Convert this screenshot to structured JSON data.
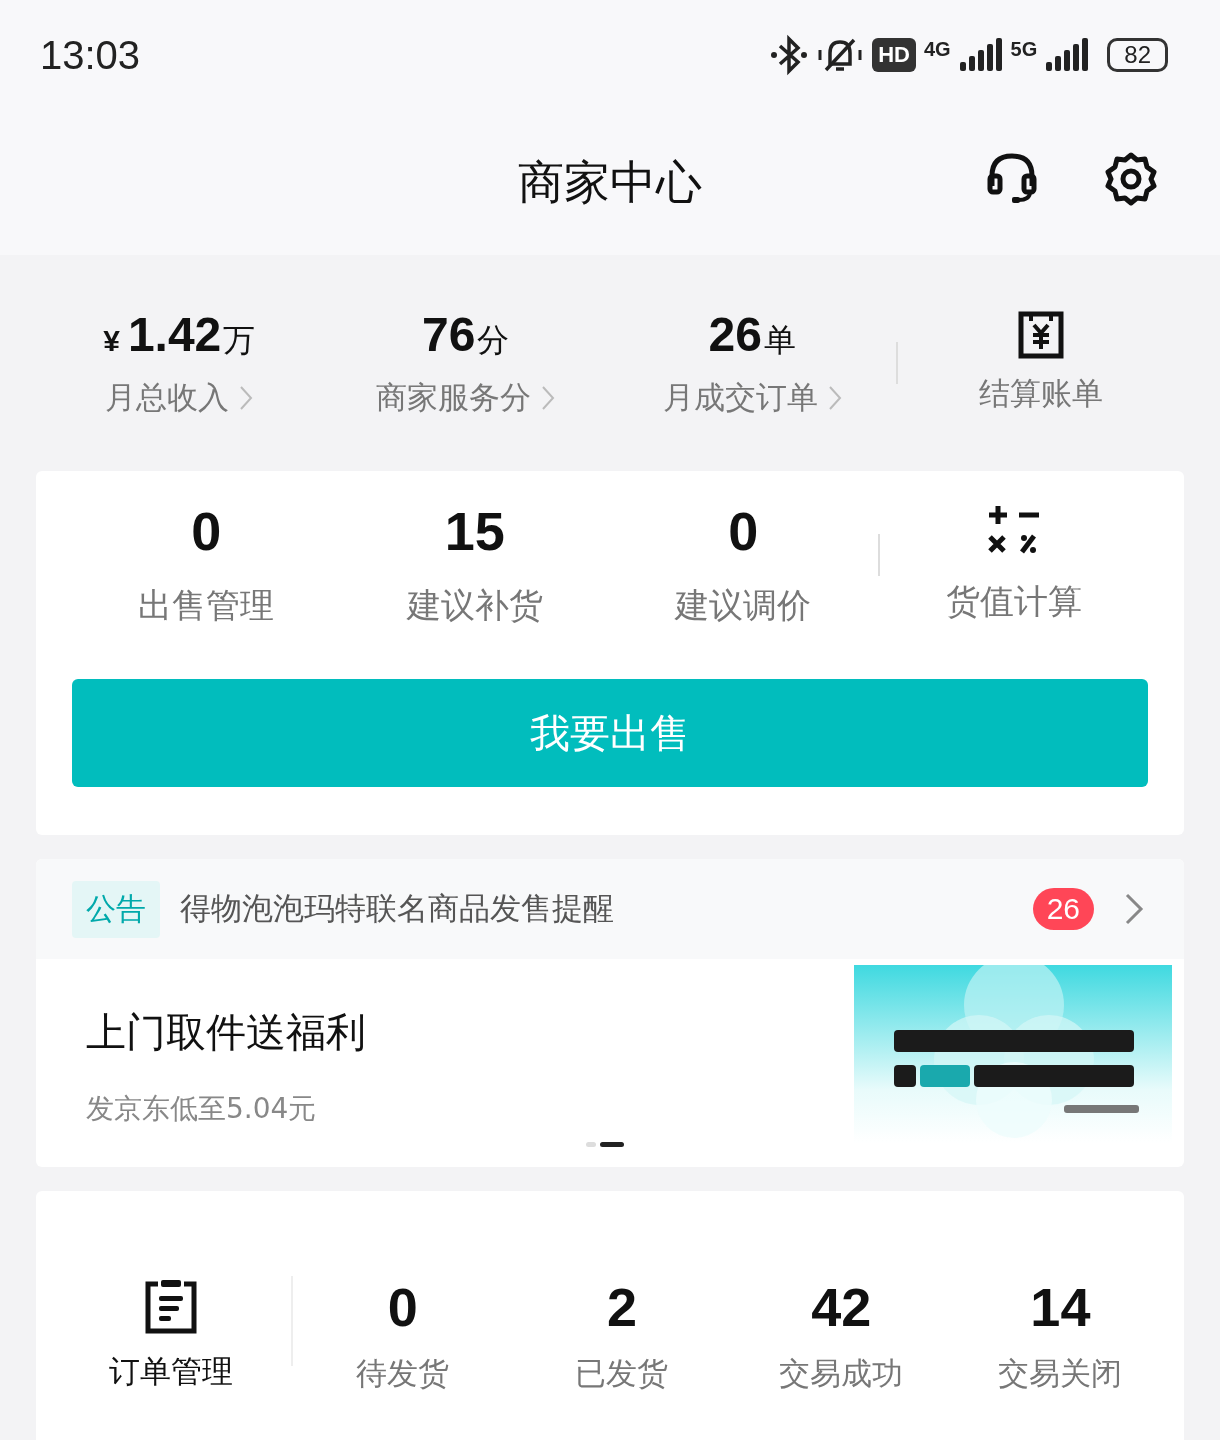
{
  "status_bar": {
    "time": "13:03",
    "hd_badge": "HD",
    "network_1": "4G",
    "network_2": "5G",
    "battery": "82"
  },
  "header": {
    "title": "商家中心"
  },
  "stats": [
    {
      "prefix": "¥",
      "value": "1.42",
      "unit": "万",
      "label": "月总收入"
    },
    {
      "value": "76",
      "unit": "分",
      "label": "商家服务分"
    },
    {
      "value": "26",
      "unit": "单",
      "label": "月成交订单"
    }
  ],
  "bill": {
    "label": "结算账单"
  },
  "sell_card": {
    "items": [
      {
        "value": "0",
        "label": "出售管理"
      },
      {
        "value": "15",
        "label": "建议补货"
      },
      {
        "value": "0",
        "label": "建议调价"
      }
    ],
    "calculator": {
      "label": "货值计算"
    },
    "button": "我要出售"
  },
  "notice": {
    "tag": "公告",
    "text": "得物泡泡玛特联名商品发售提醒",
    "count": "26"
  },
  "banner": {
    "title": "上门取件送福利",
    "subtitle": "发京东低至5.04元",
    "dots": [
      {
        "selected": false
      },
      {
        "selected": true
      }
    ]
  },
  "orders": {
    "label": "订单管理",
    "items": [
      {
        "value": "0",
        "label": "待发货"
      },
      {
        "value": "2",
        "label": "已发货"
      },
      {
        "value": "42",
        "label": "交易成功"
      },
      {
        "value": "14",
        "label": "交易关闭"
      }
    ]
  }
}
